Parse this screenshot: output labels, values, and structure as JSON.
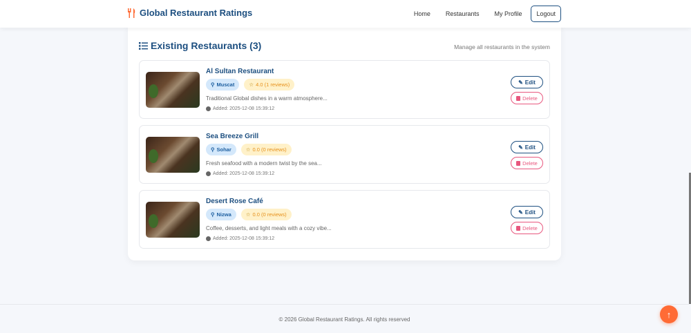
{
  "nav": {
    "brand": "Global Restaurant Ratings",
    "links": [
      "Home",
      "Restaurants",
      "My Profile"
    ],
    "logout": "Logout"
  },
  "section": {
    "title": "Existing Restaurants (3)",
    "subtitle": "Manage all restaurants in the system"
  },
  "restaurants": [
    {
      "name": "Al Sultan Restaurant",
      "city": "Muscat",
      "rating": "4.0 (1 reviews)",
      "description": "Traditional Global dishes in a warm atmosphere...",
      "added": "Added: 2025-12-08 15:39:12"
    },
    {
      "name": "Sea Breeze Grill",
      "city": "Sohar",
      "rating": "0.0 (0 reviews)",
      "description": "Fresh seafood with a modern twist by the sea...",
      "added": "Added: 2025-12-08 15:39:12"
    },
    {
      "name": "Desert Rose Café",
      "city": "Nizwa",
      "rating": "0.0 (0 reviews)",
      "description": "Coffee, desserts, and light meals with a cozy vibe...",
      "added": "Added: 2025-12-08 15:39:12"
    }
  ],
  "actions": {
    "edit": "Edit",
    "delete": "Delete"
  },
  "footer": {
    "text": "© 2026 Global Restaurant Ratings. All rights reserved"
  },
  "colors": {
    "primary": "#1d4f80",
    "accent": "#ff6b35",
    "danger": "#e8577e"
  }
}
